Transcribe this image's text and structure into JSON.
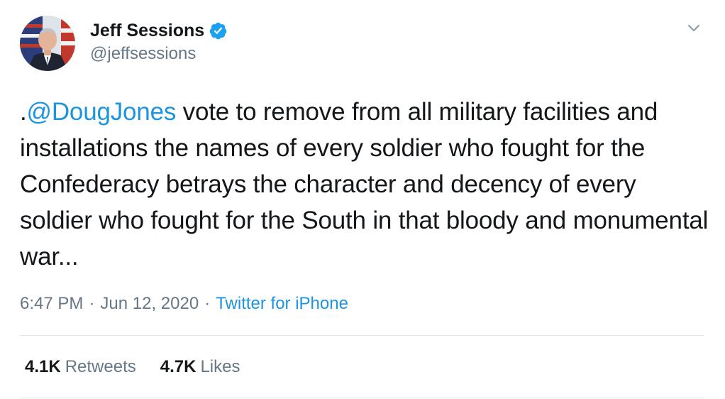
{
  "tweet": {
    "display_name": "Jeff Sessions",
    "handle": "@jeffsessions",
    "verified": true,
    "text_prefix": ".",
    "mention": "@DougJones",
    "text_rest": " vote to remove from all military facilities and installations the names of every soldier who fought for the Confederacy betrays the character and decency of every soldier who fought for the South in that bloody and monumental war...",
    "time": "6:47 PM",
    "date": "Jun 12, 2020",
    "separator": "·",
    "source": "Twitter for iPhone"
  },
  "stats": {
    "retweets_count": "4.1K",
    "retweets_label": "Retweets",
    "likes_count": "4.7K",
    "likes_label": "Likes"
  },
  "colors": {
    "link": "#1b95e0",
    "secondary_text": "#657786",
    "primary_text": "#14171a",
    "divider": "#e1e8ed"
  },
  "icons": {
    "verified": "verified-badge-icon",
    "menu": "chevron-down-icon"
  }
}
